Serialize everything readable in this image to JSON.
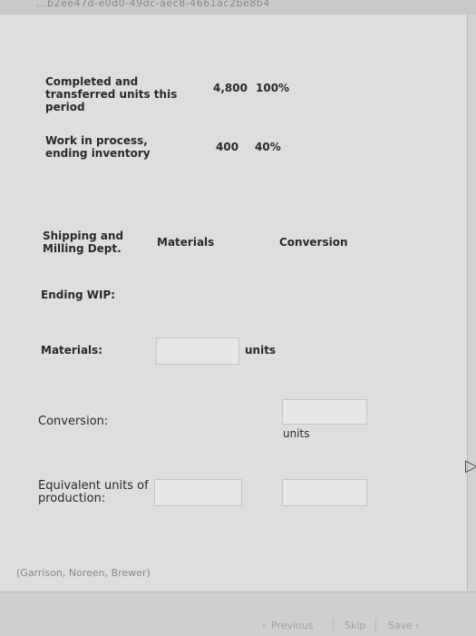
{
  "top_url": "...b2ee47d-e0d0-49dc-aec8-4661ac2be8b4",
  "rows": [
    {
      "label": "Completed and transferred units this period",
      "units": "4,800",
      "pct": "100%"
    },
    {
      "label": "Work in process, ending inventory",
      "units": "400",
      "pct": "40%"
    }
  ],
  "table_header": {
    "dept": "Shipping and Milling Dept.",
    "materials": "Materials",
    "conversion": "Conversion"
  },
  "ending_wip": "Ending WIP:",
  "materials_label": "Materials:",
  "materials_units": "units",
  "conversion_label": "Conversion:",
  "conversion_units": "units",
  "equivalent_label": "Equivalent units of production:",
  "credit": "(Garrison, Noreen, Brewer)",
  "nav": {
    "previous": "Previous",
    "skip": "Skip",
    "save": "Save"
  }
}
